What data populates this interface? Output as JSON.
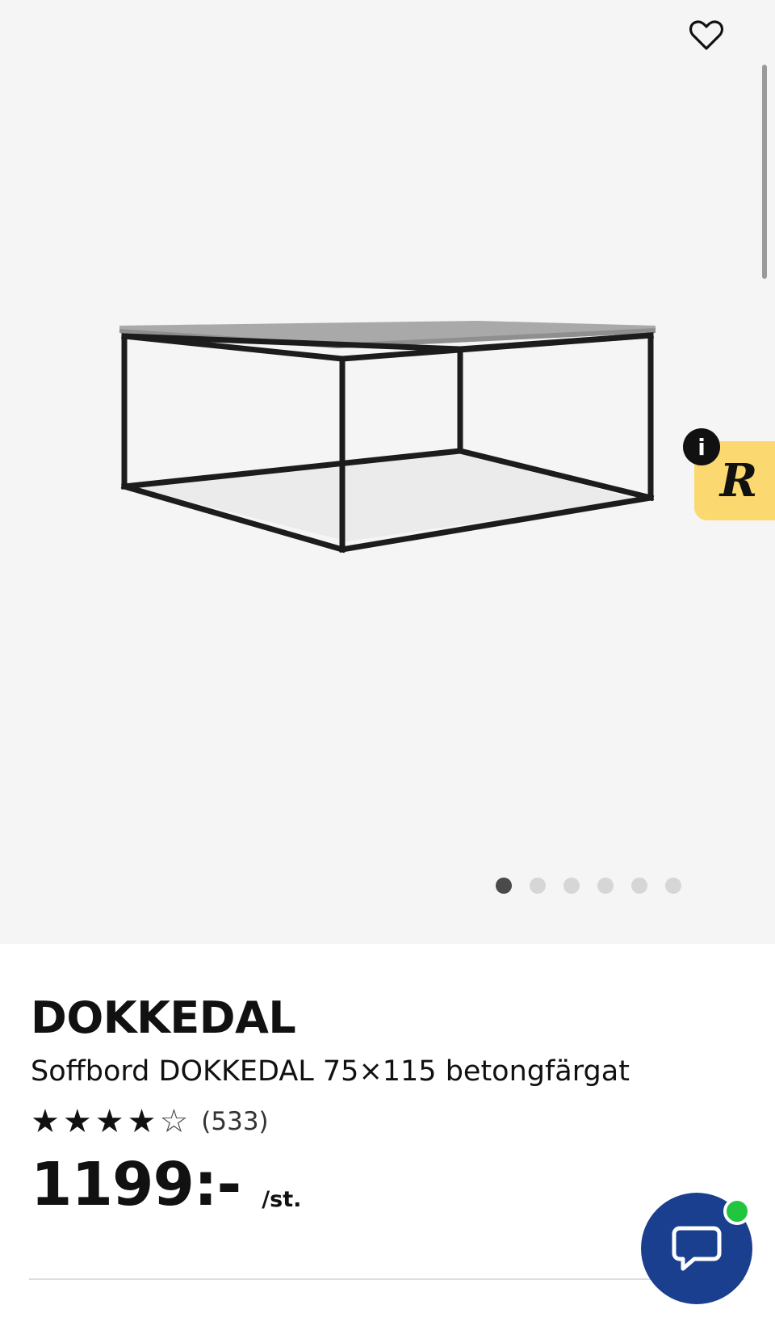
{
  "product": {
    "brand": "DOKKEDAL",
    "description": "Soffbord DOKKEDAL 75×115 betongfärgat",
    "rating_stars_filled": 4,
    "rating_stars_total": 5,
    "review_count": "(533)",
    "price": "1199:-",
    "price_unit": "/st."
  },
  "gallery": {
    "image_count": 6,
    "active_index": 0
  },
  "badge": {
    "letter": "R",
    "info_label": "i"
  },
  "colors": {
    "gallery_bg": "#f5f5f5",
    "badge_bg": "#fcd970",
    "chat_bg": "#1a3f8f",
    "online_dot": "#22c63e"
  },
  "icons": [
    "heart-icon",
    "info-icon",
    "star-icon",
    "chat-bubble-icon"
  ]
}
